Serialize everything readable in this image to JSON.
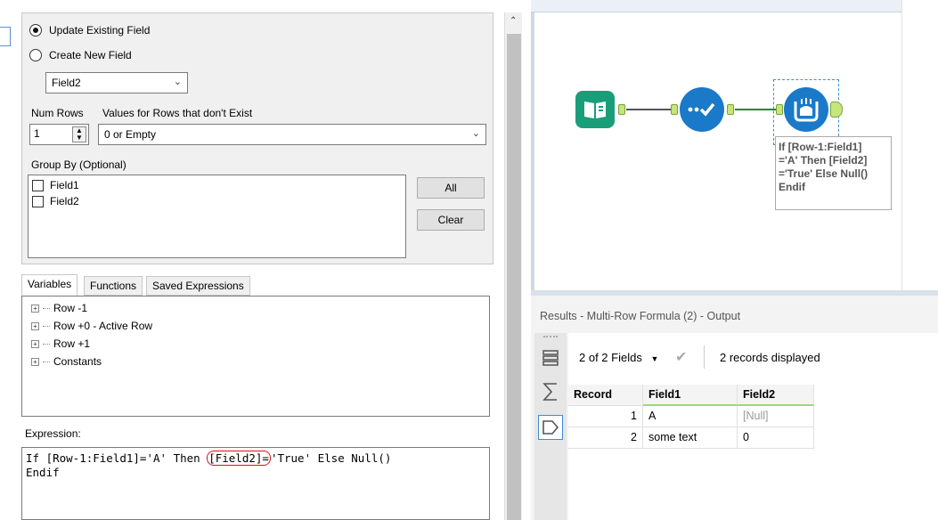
{
  "config": {
    "radio_update": "Update Existing Field",
    "radio_create": "Create New  Field",
    "field_select": "Field2",
    "num_rows_label": "Num Rows",
    "num_rows_value": "1",
    "values_label": "Values for Rows that don't Exist",
    "values_select": "0 or Empty",
    "group_by_label": "Group By (Optional)",
    "group_fields": [
      "Field1",
      "Field2"
    ],
    "all_button": "All",
    "clear_button": "Clear"
  },
  "tabs": [
    "Variables",
    "Functions",
    "Saved Expressions"
  ],
  "variables": [
    "Row -1",
    "Row +0 - Active Row",
    "Row +1",
    "Constants"
  ],
  "expression": {
    "label": "Expression:",
    "line1_a": "If [Row-1:Field1]='A' Then ",
    "line1_b": "[Field2]=",
    "line1_c": "'True' Else Null()",
    "line2": "Endif"
  },
  "canvas": {
    "annotation": "If [Row-1:Field1]\n='A' Then [Field2]\n='True' Else Null()\nEndif"
  },
  "results": {
    "title": "Results - Multi-Row Formula (2) - Output",
    "fields_button": "2 of 2 Fields",
    "records_text": "2 records displayed",
    "columns": [
      "Record",
      "Field1",
      "Field2"
    ],
    "rows": [
      {
        "record": "1",
        "field1": "A",
        "field2": "[Null]"
      },
      {
        "record": "2",
        "field1": "some text",
        "field2": "0"
      }
    ]
  },
  "colors": {
    "book_tool": "#1a9e7a",
    "sample_tool": "#1a79c8",
    "formula_tool": "#1a79c8",
    "anchor": "#c6e57a"
  }
}
